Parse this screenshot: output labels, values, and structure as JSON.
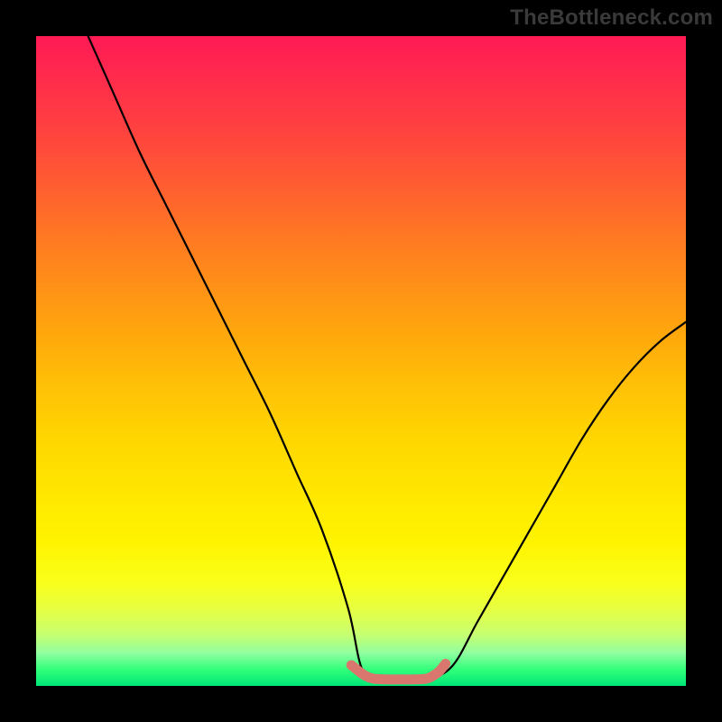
{
  "watermark": "TheBottleneck.com",
  "chart_data": {
    "type": "line",
    "title": "",
    "xlabel": "",
    "ylabel": "",
    "xlim": [
      0,
      100
    ],
    "ylim": [
      0,
      100
    ],
    "grid": false,
    "legend": false,
    "series": [
      {
        "name": "main-curve",
        "color": "#000000",
        "x": [
          8,
          12,
          16,
          20,
          24,
          28,
          32,
          36,
          40,
          44,
          48,
          50,
          52,
          54,
          56,
          58,
          60,
          64,
          68,
          72,
          76,
          80,
          84,
          88,
          92,
          96,
          100
        ],
        "y": [
          100,
          91,
          82,
          74,
          66,
          58,
          50,
          42,
          33,
          24,
          12,
          3,
          1,
          1,
          1,
          1,
          1,
          3,
          10,
          17,
          24,
          31,
          38,
          44,
          49,
          53,
          56
        ]
      },
      {
        "name": "highlight-band",
        "color": "#d9776e",
        "x": [
          48.5,
          50,
          51,
          52,
          54,
          56,
          58,
          60,
          61,
          62,
          63
        ],
        "y": [
          3.2,
          2.0,
          1.4,
          1.1,
          1.0,
          1.0,
          1.0,
          1.1,
          1.5,
          2.2,
          3.4
        ]
      }
    ],
    "annotations": []
  }
}
